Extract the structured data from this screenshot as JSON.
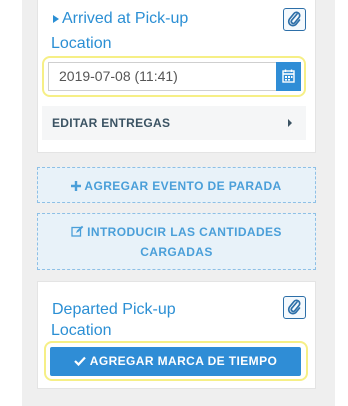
{
  "arrived": {
    "title_line1": "Arrived at Pick-up",
    "title_line2": "Location",
    "date_value": "2019-07-08  (11:41)",
    "edit_deliveries_label": "EDITAR ENTREGAS"
  },
  "add_stop_event_label": "AGREGAR EVENTO DE PARADA",
  "enter_quantities": {
    "line1": "INTRODUCIR LAS CANTIDADES",
    "line2": "CARGADAS"
  },
  "departed": {
    "title_line1": "Departed Pick-up",
    "title_line2": "Location",
    "timestamp_button_label": "AGREGAR MARCA DE TIEMPO"
  },
  "icons": {
    "attach": "paperclip-icon",
    "calendar": "calendar-icon",
    "expand": "caret-right-icon",
    "add": "plus-icon",
    "edit": "pencil-square-icon",
    "check": "check-icon"
  },
  "colors": {
    "accent": "#2f8dd6",
    "title_blue": "#2b8fd4",
    "highlight_yellow": "#f6ef86",
    "dashed_bg": "#e8f2f9"
  }
}
